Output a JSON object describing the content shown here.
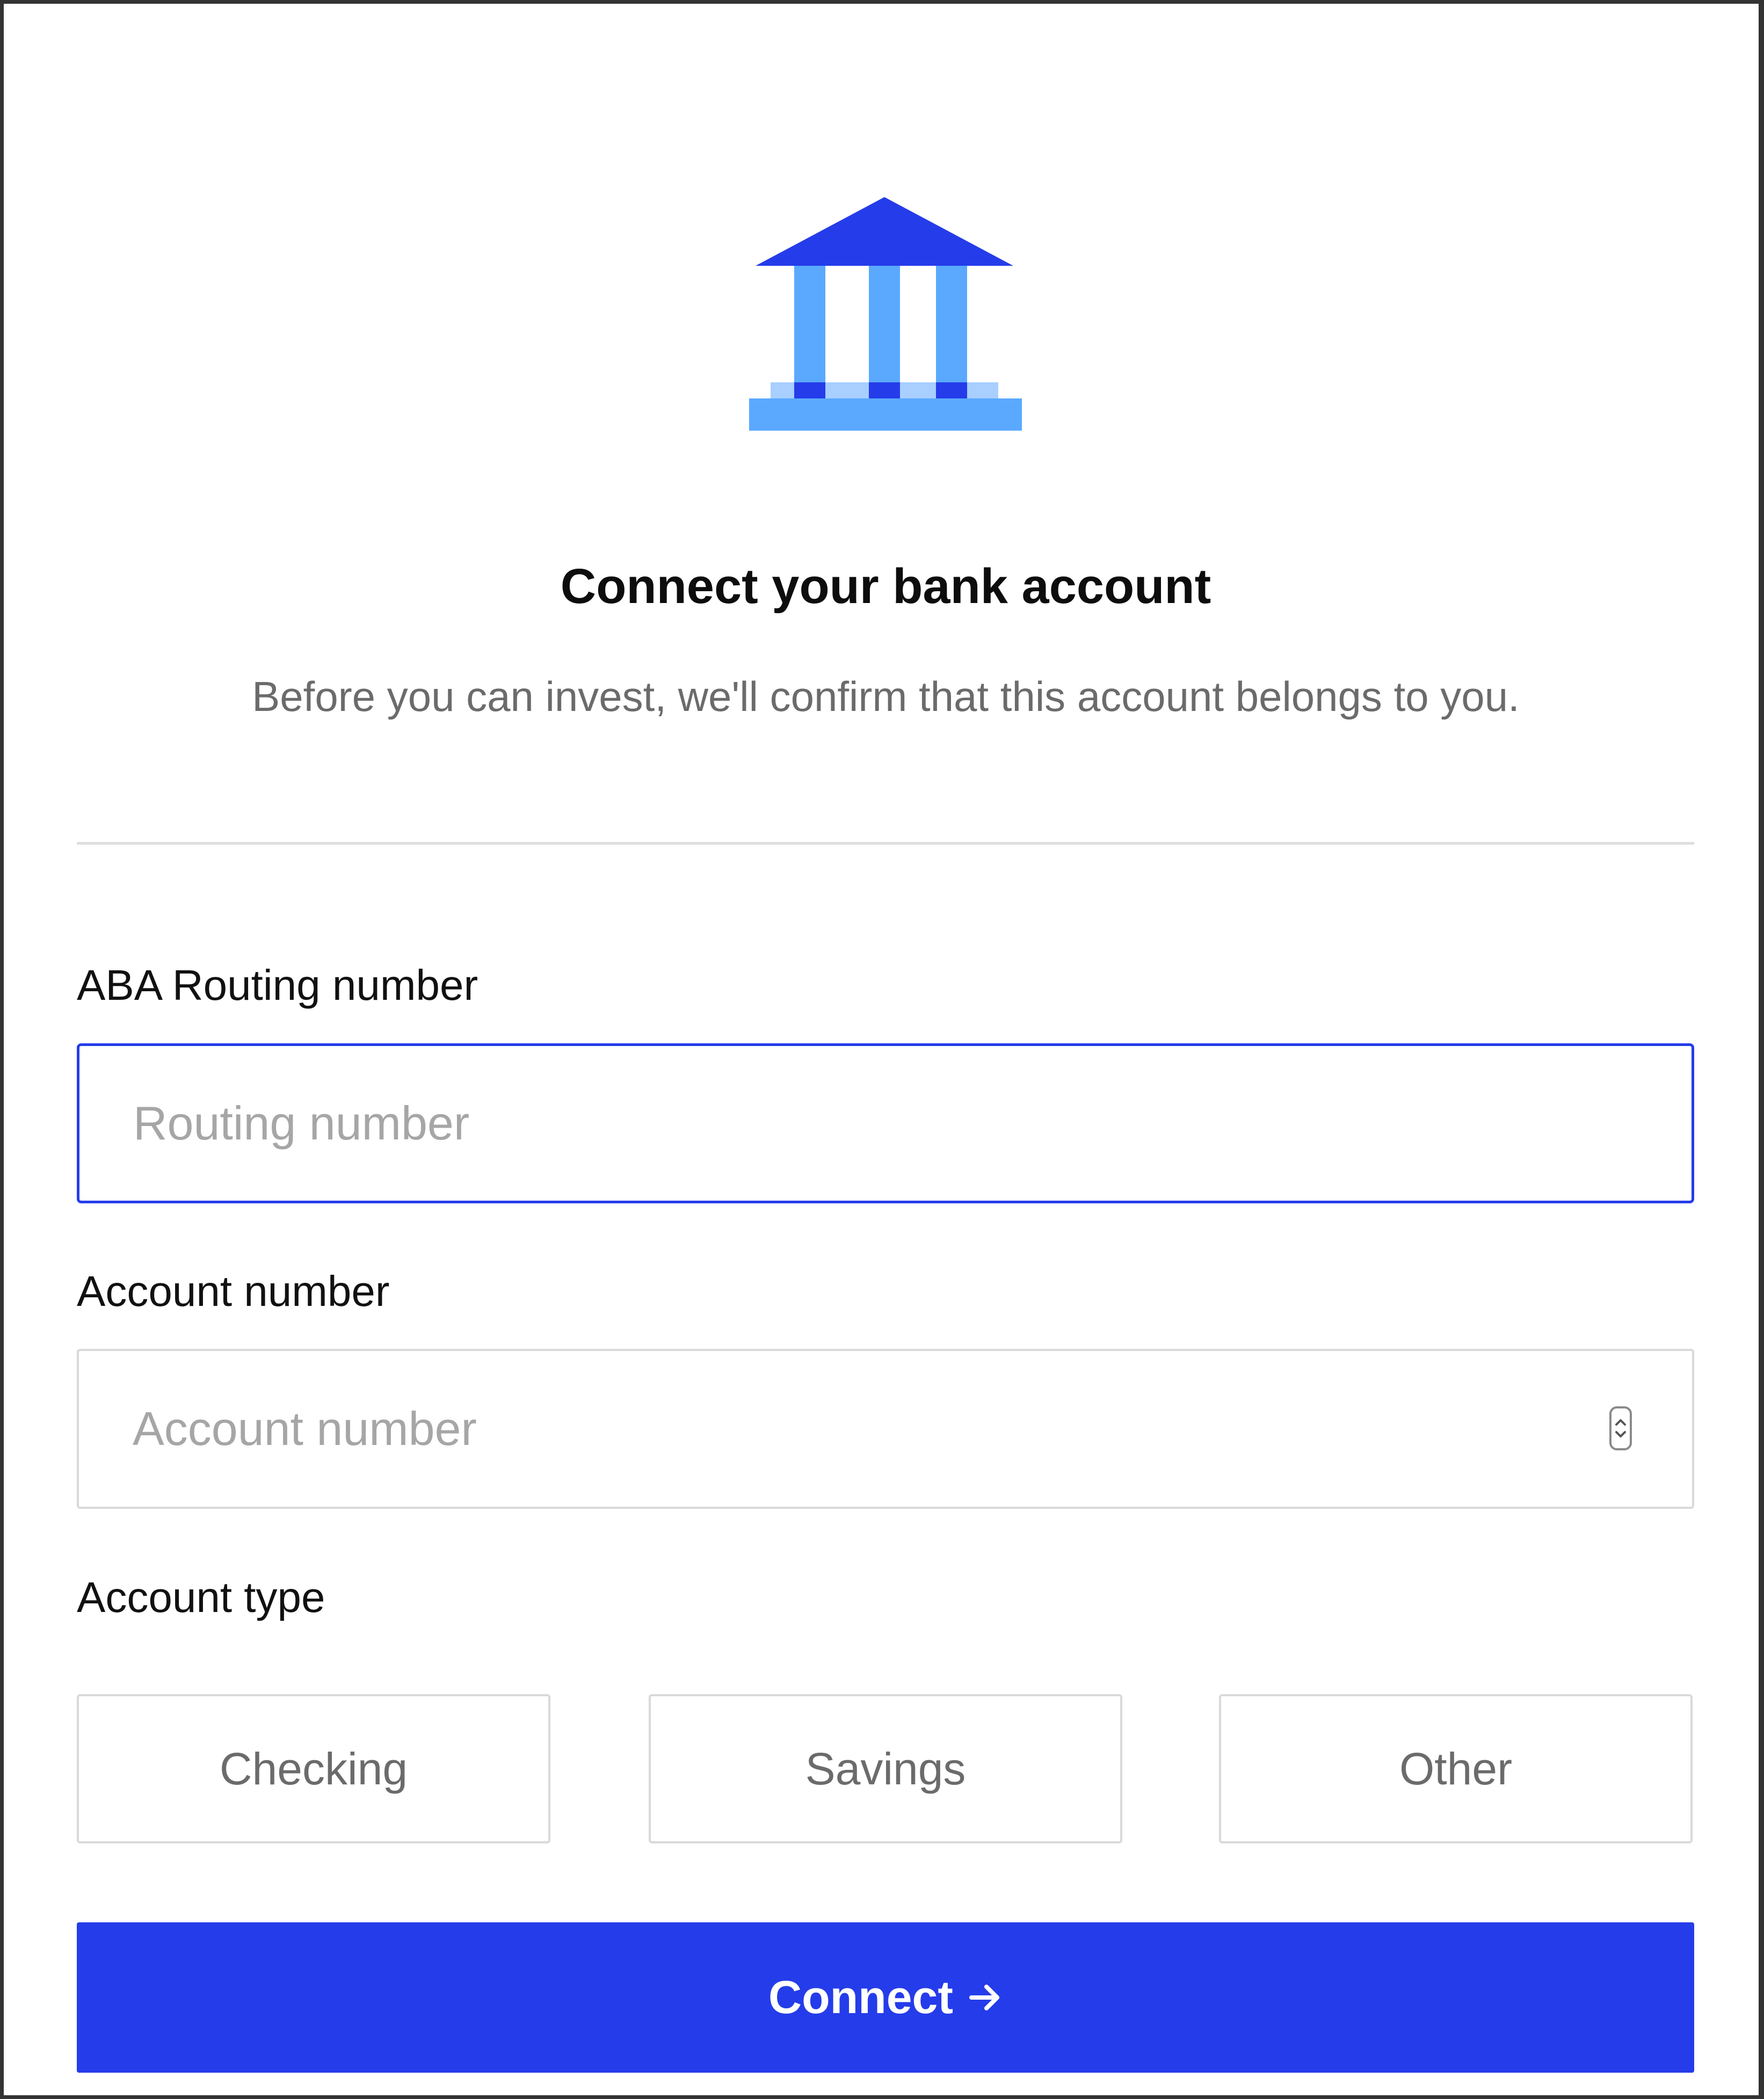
{
  "page": {
    "title": "Connect your bank account",
    "subtitle": "Before you can invest, we'll confirm that this account belongs to you.",
    "icon": "bank-icon"
  },
  "form": {
    "routing": {
      "label": "ABA Routing number",
      "placeholder": "Routing number",
      "value": "",
      "focused": true
    },
    "account": {
      "label": "Account number",
      "placeholder": "Account number",
      "value": "",
      "control": "number-stepper"
    },
    "account_type": {
      "label": "Account type",
      "options": [
        "Checking",
        "Savings",
        "Other"
      ],
      "selected": ""
    },
    "submit": {
      "label": "Connect",
      "icon": "arrow-right-icon"
    }
  },
  "colors": {
    "accent": "#253cea",
    "icon_dark": "#253cea",
    "icon_light": "#5aa9ff",
    "icon_pale": "#a8cfff",
    "label_text": "#111111",
    "muted_text": "#6b6b6b",
    "placeholder": "#a6a6a6",
    "border": "#d9d9d9"
  }
}
